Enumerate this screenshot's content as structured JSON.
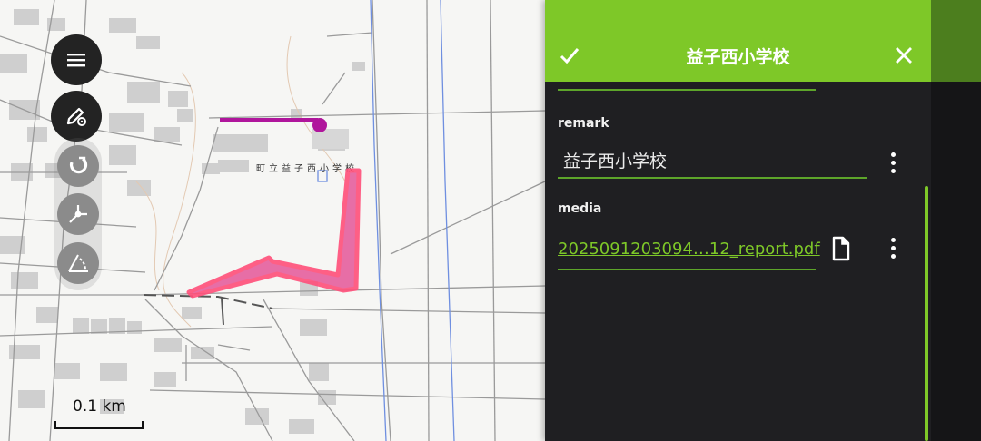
{
  "map": {
    "school_label": "町立益子西小学校",
    "scale_label": "0.1 km"
  },
  "toolbar": {
    "menu_icon": "hamburger-menu-icon",
    "edit_icon": "edit-geometry-icon",
    "tools": [
      "magnet-snap-icon",
      "vertex-tool-icon",
      "angle-measure-icon"
    ]
  },
  "panel": {
    "title": "益子西小学校",
    "confirm_icon": "check-icon",
    "close_icon": "close-icon",
    "fields": {
      "remark_label": "remark",
      "remark_value": "益子西小学校",
      "media_label": "media",
      "media_value": "2025091203094…12_report.pdf"
    }
  },
  "colors": {
    "accent": "#7ec828",
    "header_dark": "#4c7e1e",
    "panel_bg": "#1f1f22",
    "line_feature": "#b0169c",
    "polygon_fill": "#e6609e",
    "polygon_stroke": "#ff4f7a"
  }
}
